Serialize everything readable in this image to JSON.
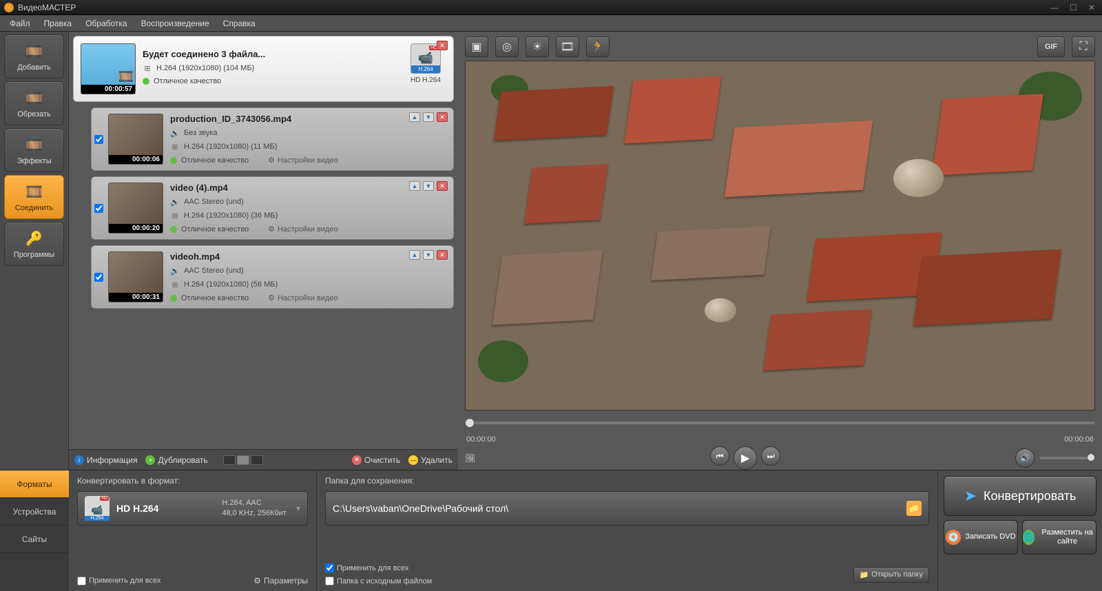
{
  "title": "ВидеоМАСТЕР",
  "menu": [
    "Файл",
    "Правка",
    "Обработка",
    "Воспроизведение",
    "Справка"
  ],
  "sidebar": [
    {
      "label": "Добавить",
      "icon": "film-plus",
      "color": "#5fbf3f"
    },
    {
      "label": "Обрезать",
      "icon": "film-cut",
      "color": "#ff5555"
    },
    {
      "label": "Эффекты",
      "icon": "film-star",
      "color": "#ffcc33"
    },
    {
      "label": "Соединить",
      "icon": "film-join",
      "color": "#4db8ff",
      "active": true
    },
    {
      "label": "Программы",
      "icon": "key",
      "color": "#ffcc33"
    }
  ],
  "merged": {
    "title": "Будет соединено 3 файла...",
    "codec_line": "H.264 (1920x1080) (104 МБ)",
    "quality": "Отличное качество",
    "duration": "00:00:57",
    "format_label": "HD H.264",
    "badge": {
      "hd": "HD",
      "codec": "H.264"
    }
  },
  "files": [
    {
      "title": "production_ID_3743056.mp4",
      "audio": "Без звука",
      "codec": "H.264 (1920x1080) (11 МБ)",
      "quality": "Отличное качество",
      "settings": "Настройки видео",
      "duration": "00:00:06",
      "checked": true
    },
    {
      "title": "video (4).mp4",
      "audio": "AAC Stereo (und)",
      "codec": "H.264 (1920x1080) (36 МБ)",
      "quality": "Отличное качество",
      "settings": "Настройки видео",
      "duration": "00:00:20",
      "checked": true
    },
    {
      "title": "videoh.mp4",
      "audio": "AAC Stereo (und)",
      "codec": "H.264 (1920x1080) (56 МБ)",
      "quality": "Отличное качество",
      "settings": "Настройки видео",
      "duration": "00:00:31",
      "checked": true
    }
  ],
  "list_toolbar": {
    "info": "Информация",
    "dup": "Дублировать",
    "clear": "Очистить",
    "del": "Удалить"
  },
  "player": {
    "time_start": "00:00:00",
    "time_end": "00:00:06"
  },
  "bottom": {
    "tabs": [
      "Форматы",
      "Устройства",
      "Сайты"
    ],
    "convert_label": "Конвертировать в формат:",
    "folder_label": "Папка для сохранения:",
    "format_name": "HD H.264",
    "format_codec1": "H.264, AAC",
    "format_codec2": "48,0 KHz, 256Кбит",
    "path": "C:\\Users\\vaban\\OneDrive\\Рабочий стол\\",
    "apply_all": "Применить для всех",
    "src_folder": "Папка с исходным файлом",
    "open_folder": "Открыть папку",
    "parameters": "Параметры",
    "convert_btn": "Конвертировать",
    "dvd_btn": "Записать DVD",
    "publish_btn": "Разместить на сайте"
  },
  "preview_toolbar_right": {
    "gif": "GIF"
  }
}
